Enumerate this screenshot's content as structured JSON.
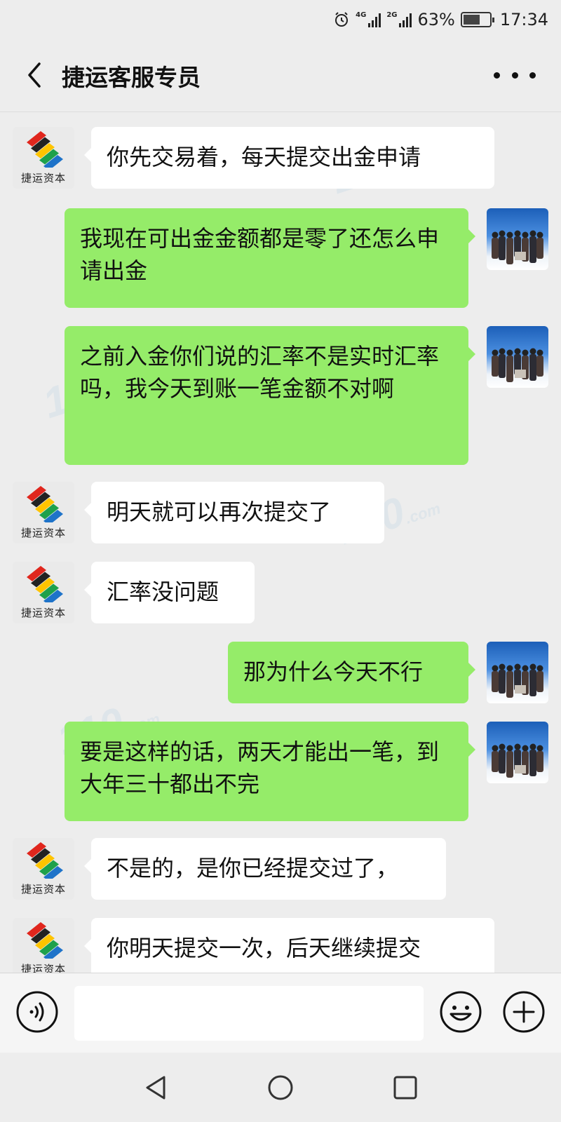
{
  "status_bar": {
    "network_1": "4G",
    "network_2": "2G",
    "battery_level": 63,
    "battery_text": "63%",
    "time": "17:34"
  },
  "header": {
    "title": "捷运客服专员",
    "back_icon": "chevron-left-icon",
    "more_icon": "more-dots-icon"
  },
  "contact": {
    "logo_text": "捷运资本",
    "logo_colors": [
      "#e0261d",
      "#222222",
      "#ffc400",
      "#1ea14b",
      "#1e73c9"
    ]
  },
  "messages": [
    {
      "sender": "agent",
      "text": "你先交易着，每天提交出金申请"
    },
    {
      "sender": "me",
      "text": "我现在可出金金额都是零了还怎么申请出金"
    },
    {
      "sender": "me",
      "text": "之前入金你们说的汇率不是实时汇率吗，我今天到账一笔金额不对啊"
    },
    {
      "sender": "agent",
      "text": "明天就可以再次提交了"
    },
    {
      "sender": "agent",
      "text": "汇率没问题"
    },
    {
      "sender": "me",
      "text": "那为什么今天不行"
    },
    {
      "sender": "me",
      "text": "要是这样的话，两天才能出一笔，到大年三十都出不完"
    },
    {
      "sender": "agent",
      "text": "不是的，是你已经提交过了，"
    },
    {
      "sender": "agent",
      "text": "你明天提交一次，后天继续提交"
    }
  ],
  "input_bar": {
    "voice_icon": "voice-icon",
    "emoji_icon": "emoji-icon",
    "plus_icon": "plus-icon",
    "value": ""
  },
  "nav": {
    "back_icon": "triangle-back-icon",
    "home_icon": "circle-home-icon",
    "recent_icon": "square-recent-icon"
  },
  "watermark": {
    "main": "110",
    "suffix": ".com"
  },
  "colors": {
    "background": "#ededed",
    "outgoing_bubble": "#95ec69",
    "incoming_bubble": "#ffffff"
  }
}
